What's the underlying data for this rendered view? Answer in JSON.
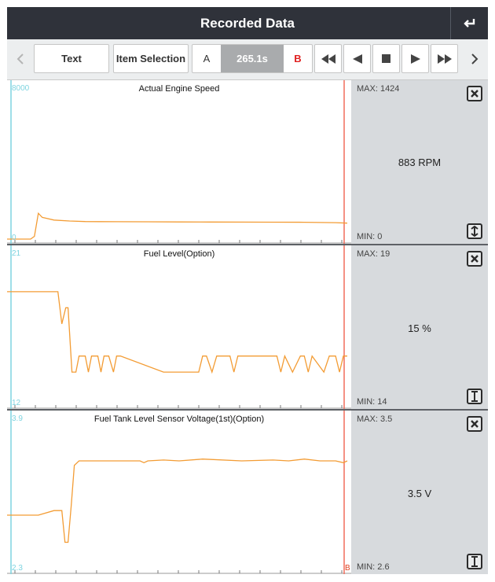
{
  "header": {
    "title": "Recorded Data",
    "back_icon": "return-arrow-icon"
  },
  "toolbar": {
    "text_label": "Text",
    "item_selection_label": "Item Selection",
    "a_label": "A",
    "time_label": "265.1s",
    "b_label": "B"
  },
  "panels": [
    {
      "title": "Actual Engine Speed",
      "y_max_label": "8000",
      "y_min_label": "0",
      "max_label": "MAX: 1424",
      "min_label": "MIN: 0",
      "current_label": "883 RPM",
      "bottom_button": "expand-vertical-icon"
    },
    {
      "title": "Fuel Level(Option)",
      "y_max_label": "21",
      "y_min_label": "12",
      "max_label": "MAX: 19",
      "min_label": "MIN: 14",
      "current_label": "15 %",
      "bottom_button": "text-cursor-icon"
    },
    {
      "title": "Fuel Tank Level Sensor Voltage(1st)(Option)",
      "y_max_label": "3.9",
      "y_min_label": "2.3",
      "max_label": "MAX: 3.5",
      "min_label": "MIN: 2.6",
      "current_label": "3.5 V",
      "bottom_button": "text-cursor-icon",
      "b_marker": "B"
    }
  ],
  "colors": {
    "trace": "#f39c34",
    "cursor_a": "#7fd4e0",
    "cursor_b": "#f26d5b",
    "titlebar": "#2f323a"
  },
  "chart_data": [
    {
      "type": "line",
      "title": "Actual Engine Speed",
      "ylim": [
        0,
        8000
      ],
      "x": [
        0,
        10,
        20,
        30,
        35,
        40,
        45,
        50,
        60,
        80,
        100,
        140,
        180,
        220,
        260,
        300,
        340,
        380,
        420,
        435
      ],
      "values": [
        0,
        0,
        0,
        0,
        150,
        1424,
        1200,
        1150,
        1050,
        1000,
        970,
        960,
        955,
        950,
        945,
        940,
        935,
        930,
        910,
        883
      ]
    },
    {
      "type": "line",
      "title": "Fuel Level(Option)",
      "ylim": [
        12,
        21
      ],
      "x": [
        0,
        65,
        70,
        75,
        78,
        83,
        88,
        92,
        100,
        104,
        108,
        116,
        120,
        124,
        130,
        136,
        140,
        145,
        200,
        245,
        250,
        255,
        262,
        268,
        285,
        290,
        295,
        300,
        345,
        350,
        355,
        365,
        375,
        380,
        385,
        390,
        405,
        412,
        420,
        425,
        430,
        435
      ],
      "values": [
        19,
        19,
        17,
        18,
        18,
        14,
        14,
        15,
        15,
        14,
        15,
        15,
        14,
        15,
        15,
        14,
        15,
        15,
        14,
        14,
        15,
        15,
        14,
        15,
        15,
        14,
        15,
        15,
        15,
        14,
        15,
        14,
        15,
        15,
        14,
        15,
        14,
        15,
        15,
        14,
        15,
        15
      ]
    },
    {
      "type": "line",
      "title": "Fuel Tank Level Sensor Voltage(1st)(Option)",
      "ylim": [
        2.3,
        3.9
      ],
      "x": [
        0,
        20,
        40,
        60,
        70,
        74,
        78,
        82,
        86,
        92,
        100,
        130,
        170,
        175,
        180,
        200,
        220,
        250,
        300,
        340,
        360,
        380,
        400,
        420,
        430,
        435
      ],
      "values": [
        2.9,
        2.9,
        2.9,
        2.95,
        2.95,
        2.6,
        2.6,
        3.0,
        3.45,
        3.5,
        3.5,
        3.5,
        3.5,
        3.48,
        3.5,
        3.51,
        3.5,
        3.52,
        3.5,
        3.51,
        3.5,
        3.52,
        3.5,
        3.5,
        3.48,
        3.5
      ]
    }
  ]
}
